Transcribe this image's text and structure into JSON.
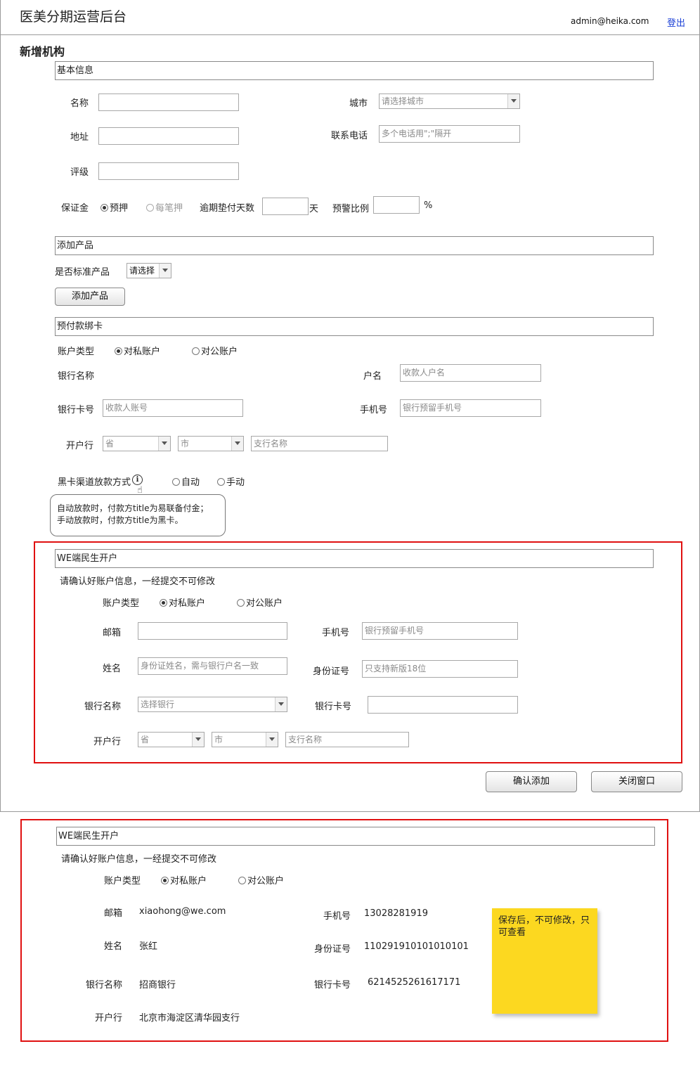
{
  "header": {
    "app_title": "医美分期运营后台",
    "user_email": "admin@heika.com",
    "logout_label": "登出"
  },
  "page_title": "新增机构",
  "basic_info": {
    "section_title": "基本信息",
    "name_label": "名称",
    "name_value": "",
    "city_label": "城市",
    "city_placeholder": "请选择城市",
    "address_label": "地址",
    "address_value": "",
    "phone_label": "联系电话",
    "phone_placeholder": "多个电话用\";\"隔开",
    "rating_label": "评级",
    "rating_value": "",
    "deposit_label": "保证金",
    "deposit_options": [
      "预押",
      "每笔押"
    ],
    "deposit_selected": "预押",
    "overdue_days_label": "逾期垫付天数",
    "overdue_days_unit": "天",
    "warning_ratio_label": "预警比例",
    "warning_ratio_unit": "%"
  },
  "add_product": {
    "section_title": "添加产品",
    "standard_label": "是否标准产品",
    "standard_select": "请选择",
    "add_button": "添加产品"
  },
  "prepaid_card": {
    "section_title": "预付款绑卡",
    "account_type_label": "账户类型",
    "account_type_options": [
      "对私账户",
      "对公账户"
    ],
    "account_type_selected": "对私账户",
    "bank_name_label": "银行名称",
    "account_name_label": "户名",
    "account_name_placeholder": "收款人户名",
    "card_no_label": "银行卡号",
    "card_no_placeholder": "收款人账号",
    "mobile_label": "手机号",
    "mobile_placeholder": "银行预留手机号",
    "branch_label": "开户行",
    "province_placeholder": "省",
    "city_placeholder": "市",
    "branch_placeholder": "支行名称",
    "loan_mode_label": "黑卡渠道放款方式",
    "loan_mode_options": [
      "自动",
      "手动"
    ],
    "tooltip_line1": "自动放款时，付款方title为易联备付金；",
    "tooltip_line2": "手动放款时，付款方title为黑卡。"
  },
  "we_form": {
    "section_title": "WE端民生开户",
    "notice": "请确认好账户信息，一经提交不可修改",
    "account_type_label": "账户类型",
    "account_type_options": [
      "对私账户",
      "对公账户"
    ],
    "account_type_selected": "对私账户",
    "email_label": "邮箱",
    "email_value": "",
    "mobile_label": "手机号",
    "mobile_placeholder": "银行预留手机号",
    "name_label": "姓名",
    "name_placeholder": "身份证姓名，需与银行户名一致",
    "id_label": "身份证号",
    "id_placeholder": "只支持新版18位",
    "bank_name_label": "银行名称",
    "bank_select_placeholder": "选择银行",
    "card_no_label": "银行卡号",
    "card_no_value": "",
    "branch_label": "开户行",
    "province_placeholder": "省",
    "city_placeholder": "市",
    "branch_placeholder": "支行名称"
  },
  "actions": {
    "confirm_label": "确认添加",
    "close_label": "关闭窗口"
  },
  "we_view": {
    "section_title": "WE端民生开户",
    "notice": "请确认好账户信息，一经提交不可修改",
    "account_type_label": "账户类型",
    "account_type_options": [
      "对私账户",
      "对公账户"
    ],
    "account_type_selected": "对私账户",
    "email_label": "邮箱",
    "email_value": "xiaohong@we.com",
    "mobile_label": "手机号",
    "mobile_value": "13028281919",
    "name_label": "姓名",
    "name_value": "张红",
    "id_label": "身份证号",
    "id_value": "110291910101010101",
    "bank_name_label": "银行名称",
    "bank_name_value": "招商银行",
    "card_no_label": "银行卡号",
    "card_no_value": "6214525261617171",
    "branch_label": "开户行",
    "branch_value": "北京市海淀区清华园支行"
  },
  "sticky_note": "保存后，不可修改，只可查看",
  "colors": {
    "highlight_border": "#e01010",
    "sticky_bg": "#fcd820",
    "link": "#1a3fd6"
  }
}
